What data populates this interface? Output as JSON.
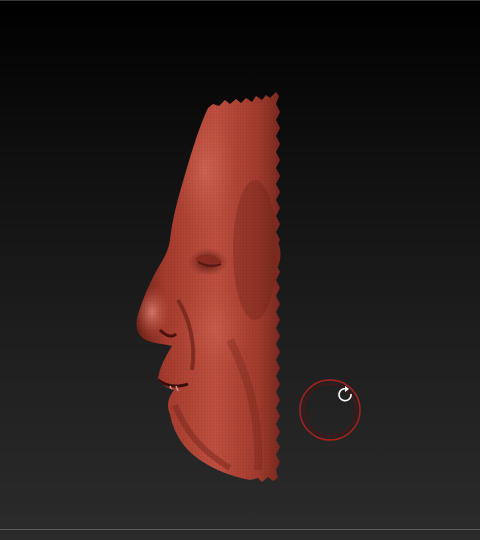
{
  "canvas": {
    "background_top": "#000000",
    "background_bottom": "#2b2b2b"
  },
  "model": {
    "type": "sculpt-mesh",
    "subject": "head-profile-half",
    "material_color": "#b84a3a",
    "highlight_color": "#d8705e",
    "shadow_color": "#5a1a14"
  },
  "gizmo": {
    "ring_color": "#a82020",
    "icon": "rotate-icon",
    "icon_color": "#ffffff"
  }
}
